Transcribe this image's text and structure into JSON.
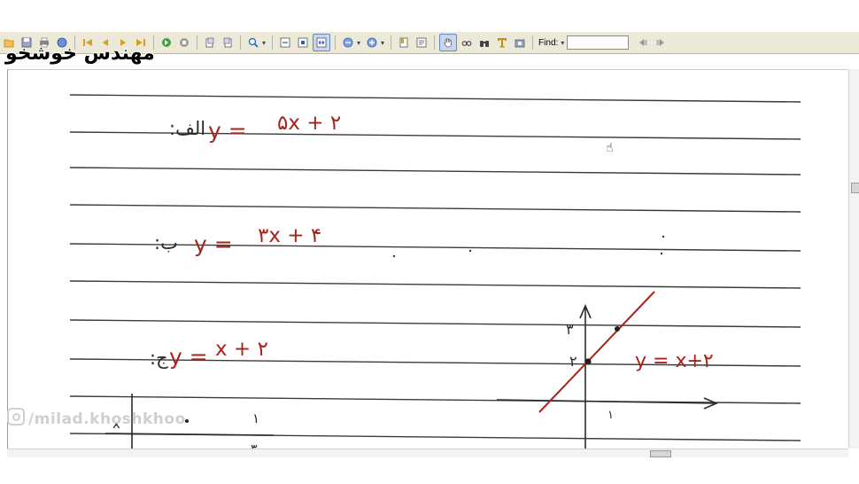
{
  "toolbar": {
    "find_label": "Find:",
    "find_value": "",
    "icons": [
      "open-file-icon",
      "save-icon",
      "print-icon",
      "email-icon",
      "first-page-icon",
      "previous-page-icon",
      "next-page-icon",
      "last-page-icon",
      "go-forward-icon",
      "go-back-icon",
      "rotate-left-icon",
      "rotate-right-icon",
      "zoom-icon",
      "fit-width-icon",
      "fit-page-icon",
      "actual-size-icon",
      "zoom-out-icon",
      "zoom-in-icon",
      "bookmark-icon",
      "properties-icon",
      "hand-tool-icon",
      "glasses-icon",
      "binoculars-icon",
      "text-tool-icon",
      "snapshot-icon"
    ]
  },
  "watermark": {
    "text": "مهندس خوشخو"
  },
  "handle": {
    "text": "/milad.khoshkhoo"
  },
  "notes": {
    "line1_label": "الف:",
    "line1_eq_left": "y =",
    "line1_eq_right": "۵x + ۲",
    "line2_label": "ب:",
    "line2_eq_left": "y =",
    "line2_eq_right": "۳x + ۴",
    "line3_label": "ج:",
    "line3_eq_left": "y =",
    "line3_eq_right": "x + ۲",
    "graph_label": "y = x+۲",
    "graph_y_tick_3": "۳",
    "graph_y_tick_2": "۲",
    "graph_x_tick_1": "۱",
    "table_header_x": "x",
    "table_val_1": "۱",
    "table_row2_a": "۰",
    "table_row2_b": "۰",
    "table_row2_c": "۳"
  },
  "colors": {
    "ink_red": "#a8231a",
    "ink_dark": "#2a2a2a",
    "rule_line": "#3a3a3a",
    "toolbar_bg": "#ece9d8"
  }
}
